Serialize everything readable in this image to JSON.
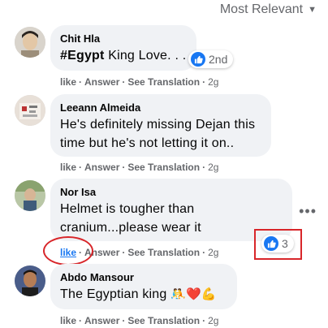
{
  "sort_label": "Most Relevant",
  "comments": [
    {
      "name": "Chit Hla",
      "hashtag": "#Egypt",
      "text": " King Love. . .",
      "reaction_count": "2nd",
      "actions": {
        "like": "like",
        "answer": "Answer",
        "translation": "See Translation",
        "time": "2g"
      }
    },
    {
      "name": "Leeann Almeida",
      "line1": "He's definitely missing Dejan this",
      "line2": "time but he's not letting it on..",
      "actions": {
        "like": "like",
        "answer": "Answer",
        "translation": "See Translation",
        "time": "2g"
      }
    },
    {
      "name": "Nor Isa",
      "line1": "Helmet is tougher than",
      "line2": "cranium...please wear it",
      "reaction_count": "3",
      "actions": {
        "like": "like",
        "answer": "Answer",
        "translation": "See Translation",
        "time": "2g"
      }
    },
    {
      "name": "Abdo Mansour",
      "text": "The Egyptian king",
      "emoji": "🤼❤️💪",
      "actions": {
        "like": "like",
        "answer": "Answer",
        "translation": "See Translation",
        "time": "2g"
      }
    }
  ],
  "colors": {
    "accent": "#1877f2",
    "highlight": "#d8262a",
    "bubble": "#f0f2f5",
    "muted": "#65676b"
  }
}
